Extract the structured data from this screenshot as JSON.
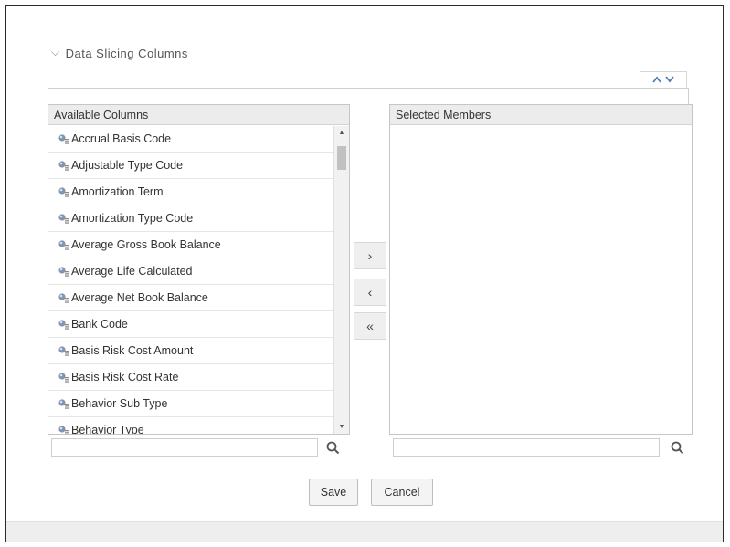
{
  "section": {
    "title": "Data Slicing Columns",
    "collapse_icon": "chevron-down-icon"
  },
  "sort_controls": {
    "up_icon": "chevron-up-icon",
    "down_icon": "chevron-down-icon",
    "accent_color": "#4a7fb5"
  },
  "available": {
    "header": "Available Columns",
    "items": [
      "Accrual Basis Code",
      "Adjustable Type Code",
      "Amortization Term",
      "Amortization Type Code",
      "Average Gross Book Balance",
      "Average Life Calculated",
      "Average Net Book Balance",
      "Bank Code",
      "Basis Risk Cost Amount",
      "Basis Risk Cost Rate",
      "Behavior Sub Type",
      "Behavior Type"
    ],
    "item_icon": "column-icon",
    "search_placeholder": "",
    "search_icon": "search-icon"
  },
  "selected": {
    "header": "Selected Members",
    "items": [],
    "search_placeholder": "",
    "search_icon": "search-icon"
  },
  "move_buttons": {
    "add": "›",
    "remove": "‹",
    "remove_all": "«"
  },
  "actions": {
    "save": "Save",
    "cancel": "Cancel"
  }
}
